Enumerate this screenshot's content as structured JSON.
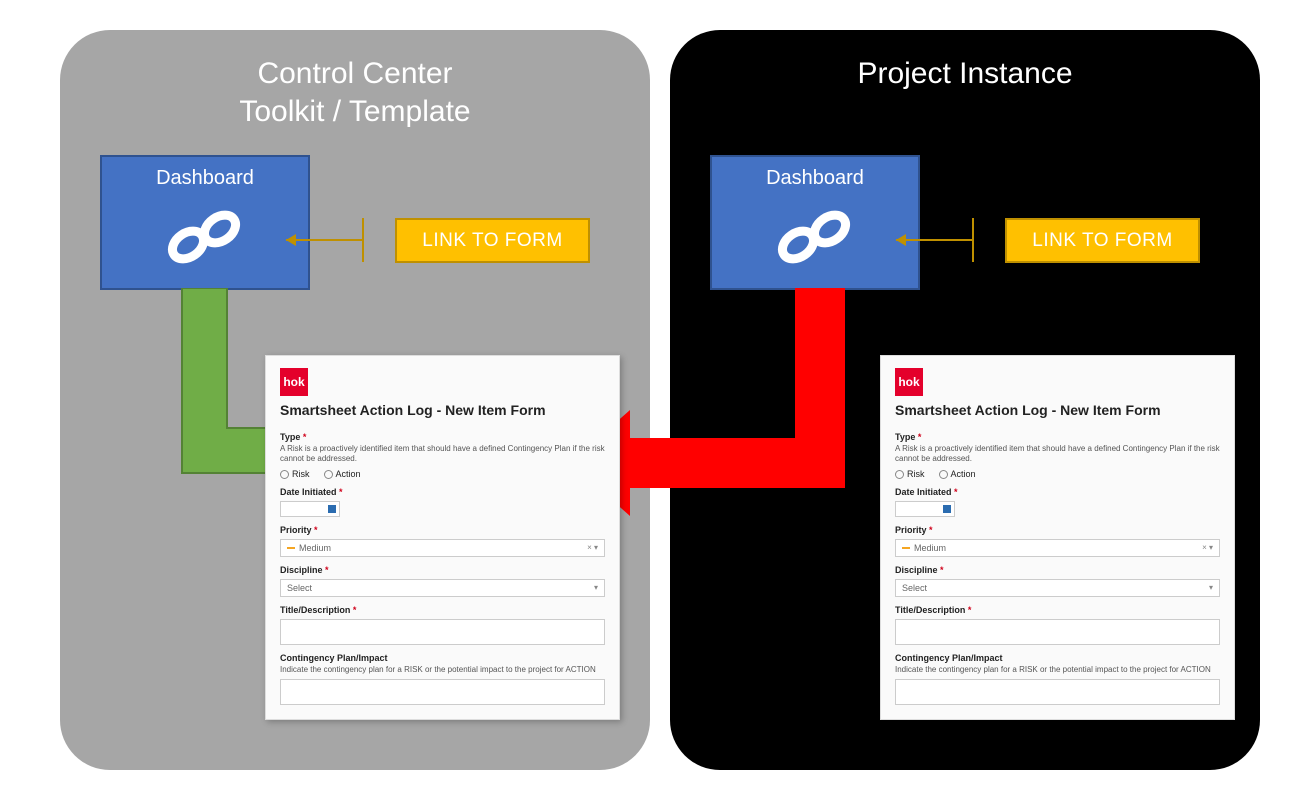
{
  "left_panel": {
    "title_line1": "Control Center",
    "title_line2": "Toolkit / Template",
    "dashboard_label": "Dashboard",
    "link_badge": "LINK TO FORM"
  },
  "right_panel": {
    "title": "Project Instance",
    "dashboard_label": "Dashboard",
    "link_badge": "LINK TO FORM"
  },
  "form": {
    "logo_text": "hok",
    "title": "Smartsheet Action Log - New Item Form",
    "type_label": "Type",
    "type_help": "A Risk is a proactively identified item that should have a defined Contingency Plan if the risk cannot be addressed.",
    "radio_risk": "Risk",
    "radio_action": "Action",
    "date_label": "Date Initiated",
    "priority_label": "Priority",
    "priority_value": "Medium",
    "discipline_label": "Discipline",
    "discipline_placeholder": "Select",
    "title_desc_label": "Title/Description",
    "contingency_label": "Contingency Plan/Impact",
    "contingency_help": "Indicate the contingency plan for a RISK or the potential impact to the project for ACTION"
  },
  "colors": {
    "panel_gray": "#a6a6a6",
    "panel_black": "#000000",
    "dashboard_blue": "#4472c4",
    "badge_yellow": "#ffc000",
    "arrow_green": "#70ad47",
    "arrow_red": "#ff0000"
  }
}
